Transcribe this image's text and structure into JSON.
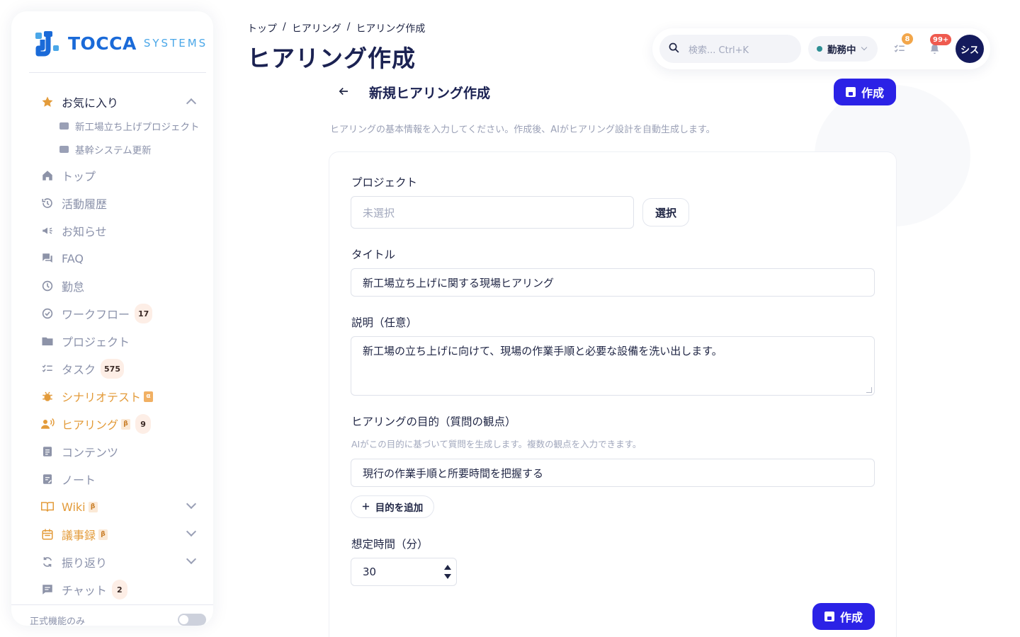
{
  "brand": {
    "name_strong": "TOCCA",
    "name_light": "SYSTEMS"
  },
  "sidebar": {
    "favorites_label": "お気に入り",
    "favorites": [
      "新工場立ち上げプロジェクト",
      "基幹システム更新"
    ],
    "items": [
      {
        "label": "トップ",
        "icon": "home-icon"
      },
      {
        "label": "活動履歴",
        "icon": "history-icon"
      },
      {
        "label": "お知らせ",
        "icon": "megaphone-icon"
      },
      {
        "label": "FAQ",
        "icon": "chat-bubbles-icon"
      },
      {
        "label": "勤怠",
        "icon": "clock-icon"
      },
      {
        "label": "ワークフロー",
        "icon": "check-circle-icon",
        "count": "17"
      },
      {
        "label": "プロジェクト",
        "icon": "folder-icon"
      },
      {
        "label": "タスク",
        "icon": "checklist-icon",
        "count": "575"
      },
      {
        "label": "シナリオテスト",
        "icon": "bug-icon",
        "tag": "α"
      },
      {
        "label": "ヒアリング",
        "icon": "interview-icon",
        "tag": "β",
        "count": "9"
      },
      {
        "label": "コンテンツ",
        "icon": "document-icon"
      },
      {
        "label": "ノート",
        "icon": "note-icon"
      },
      {
        "label": "Wiki",
        "icon": "book-icon",
        "tag": "β"
      },
      {
        "label": "議事録",
        "icon": "calendar-icon",
        "tag": "β"
      },
      {
        "label": "振り返り",
        "icon": "refresh-icon"
      },
      {
        "label": "チャット",
        "icon": "chat-icon",
        "count": "2"
      }
    ],
    "official_only_label": "正式機能のみ"
  },
  "header": {
    "breadcrumb": [
      "トップ",
      "ヒアリング",
      "ヒアリング作成"
    ],
    "breadcrumb_sep": "/",
    "title": "ヒアリング作成"
  },
  "topbar": {
    "search_placeholder": "検索... Ctrl+K",
    "status": "勤務中",
    "tasks_badge": "8",
    "notifications_badge": "99+",
    "avatar_initials": "シス"
  },
  "form": {
    "heading": "新規ヒアリング作成",
    "create_label": "作成",
    "intro": "ヒアリングの基本情報を入力してください。作成後、AIがヒアリング設計を自動生成します。",
    "project_label": "プロジェクト",
    "project_placeholder": "未選択",
    "select_label": "選択",
    "title_label": "タイトル",
    "title_value": "新工場立ち上げに関する現場ヒアリング",
    "description_label": "説明（任意）",
    "description_value": "新工場の立ち上げに向けて、現場の作業手順と必要な設備を洗い出します。",
    "purpose_label": "ヒアリングの目的（質問の観点）",
    "purpose_hint": "AIがこの目的に基づいて質問を生成します。複数の観点を入力できます。",
    "purpose_value": "現行の作業手順と所要時間を把握する",
    "add_purpose_label": "目的を追加",
    "duration_label": "想定時間（分）",
    "duration_value": "30"
  },
  "colors": {
    "primary": "#2b22e6",
    "accent_orange": "#e39b3a",
    "navy": "#1b2252",
    "badge_red": "#ef5a4f",
    "badge_orange": "#f2a64a"
  }
}
